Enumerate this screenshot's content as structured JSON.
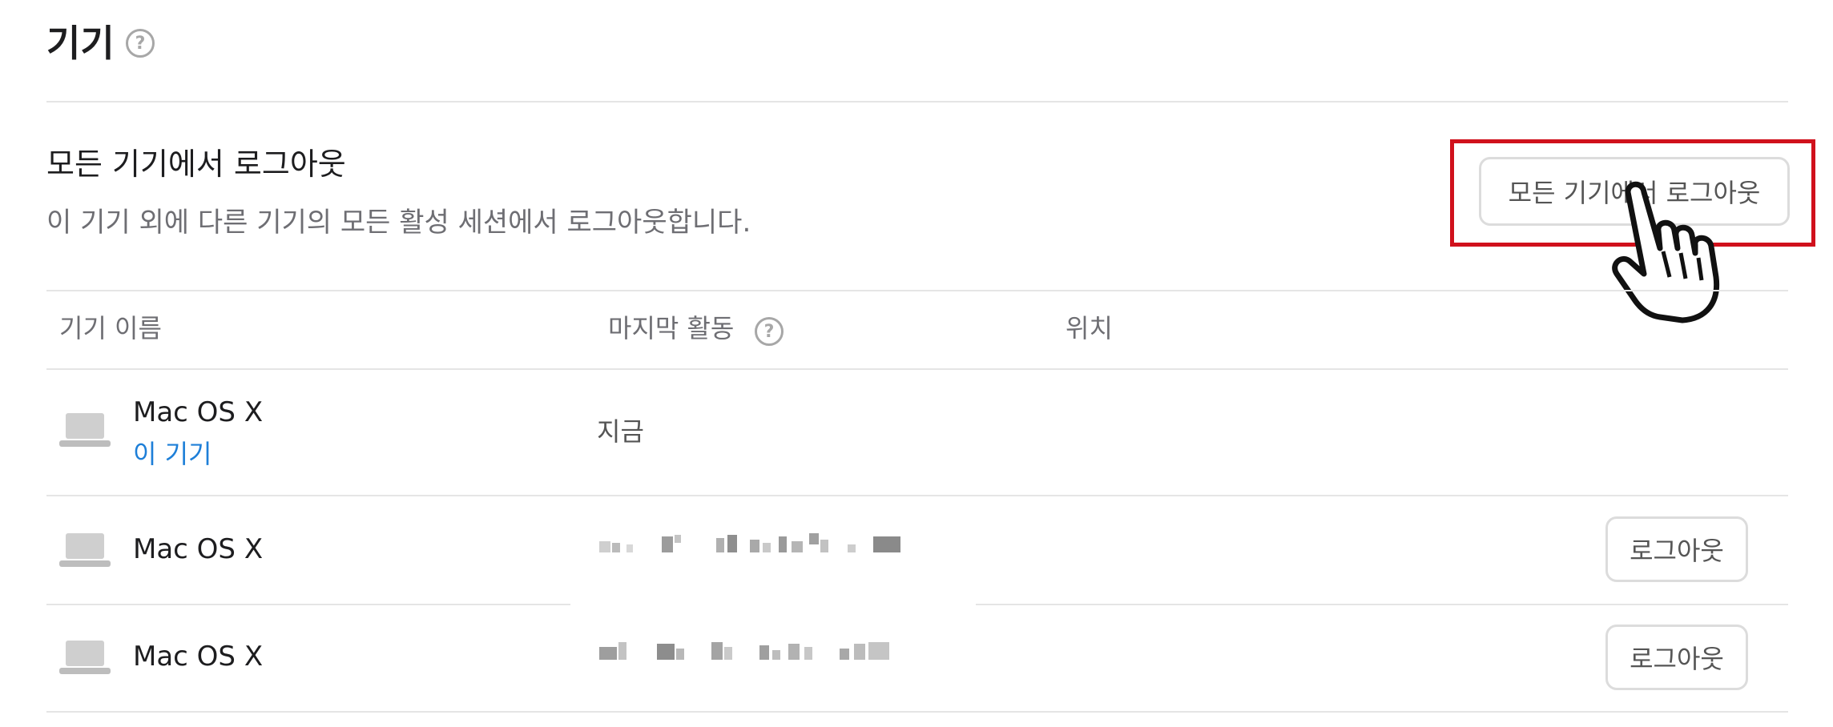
{
  "page": {
    "title": "기기",
    "title_help_glyph": "?"
  },
  "logout_all": {
    "heading": "모든 기기에서 로그아웃",
    "description": "이 기기 외에 다른 기기의 모든 활성 세션에서 로그아웃합니다.",
    "button_label": "모든 기기에서 로그아웃"
  },
  "table": {
    "headers": {
      "device_name": "기기 이름",
      "last_activity": "마지막 활동",
      "last_activity_help_glyph": "?",
      "location": "위치"
    },
    "rows": [
      {
        "device": "Mac OS X",
        "sublabel": "이 기기",
        "last_activity": "지금",
        "location": "",
        "action": ""
      },
      {
        "device": "Mac OS X",
        "sublabel": "",
        "last_activity": "",
        "location": "",
        "action": "로그아웃"
      },
      {
        "device": "Mac OS X",
        "sublabel": "",
        "last_activity": "",
        "location": "",
        "action": "로그아웃"
      }
    ]
  },
  "colors": {
    "highlight_border": "#d0111c",
    "link_blue": "#1e7fd8",
    "divider": "#e5e5e5",
    "muted_text": "#6e6e73"
  },
  "icons": {
    "device": "laptop-icon",
    "help": "question-circle-icon",
    "cursor": "pointing-hand-cursor"
  }
}
